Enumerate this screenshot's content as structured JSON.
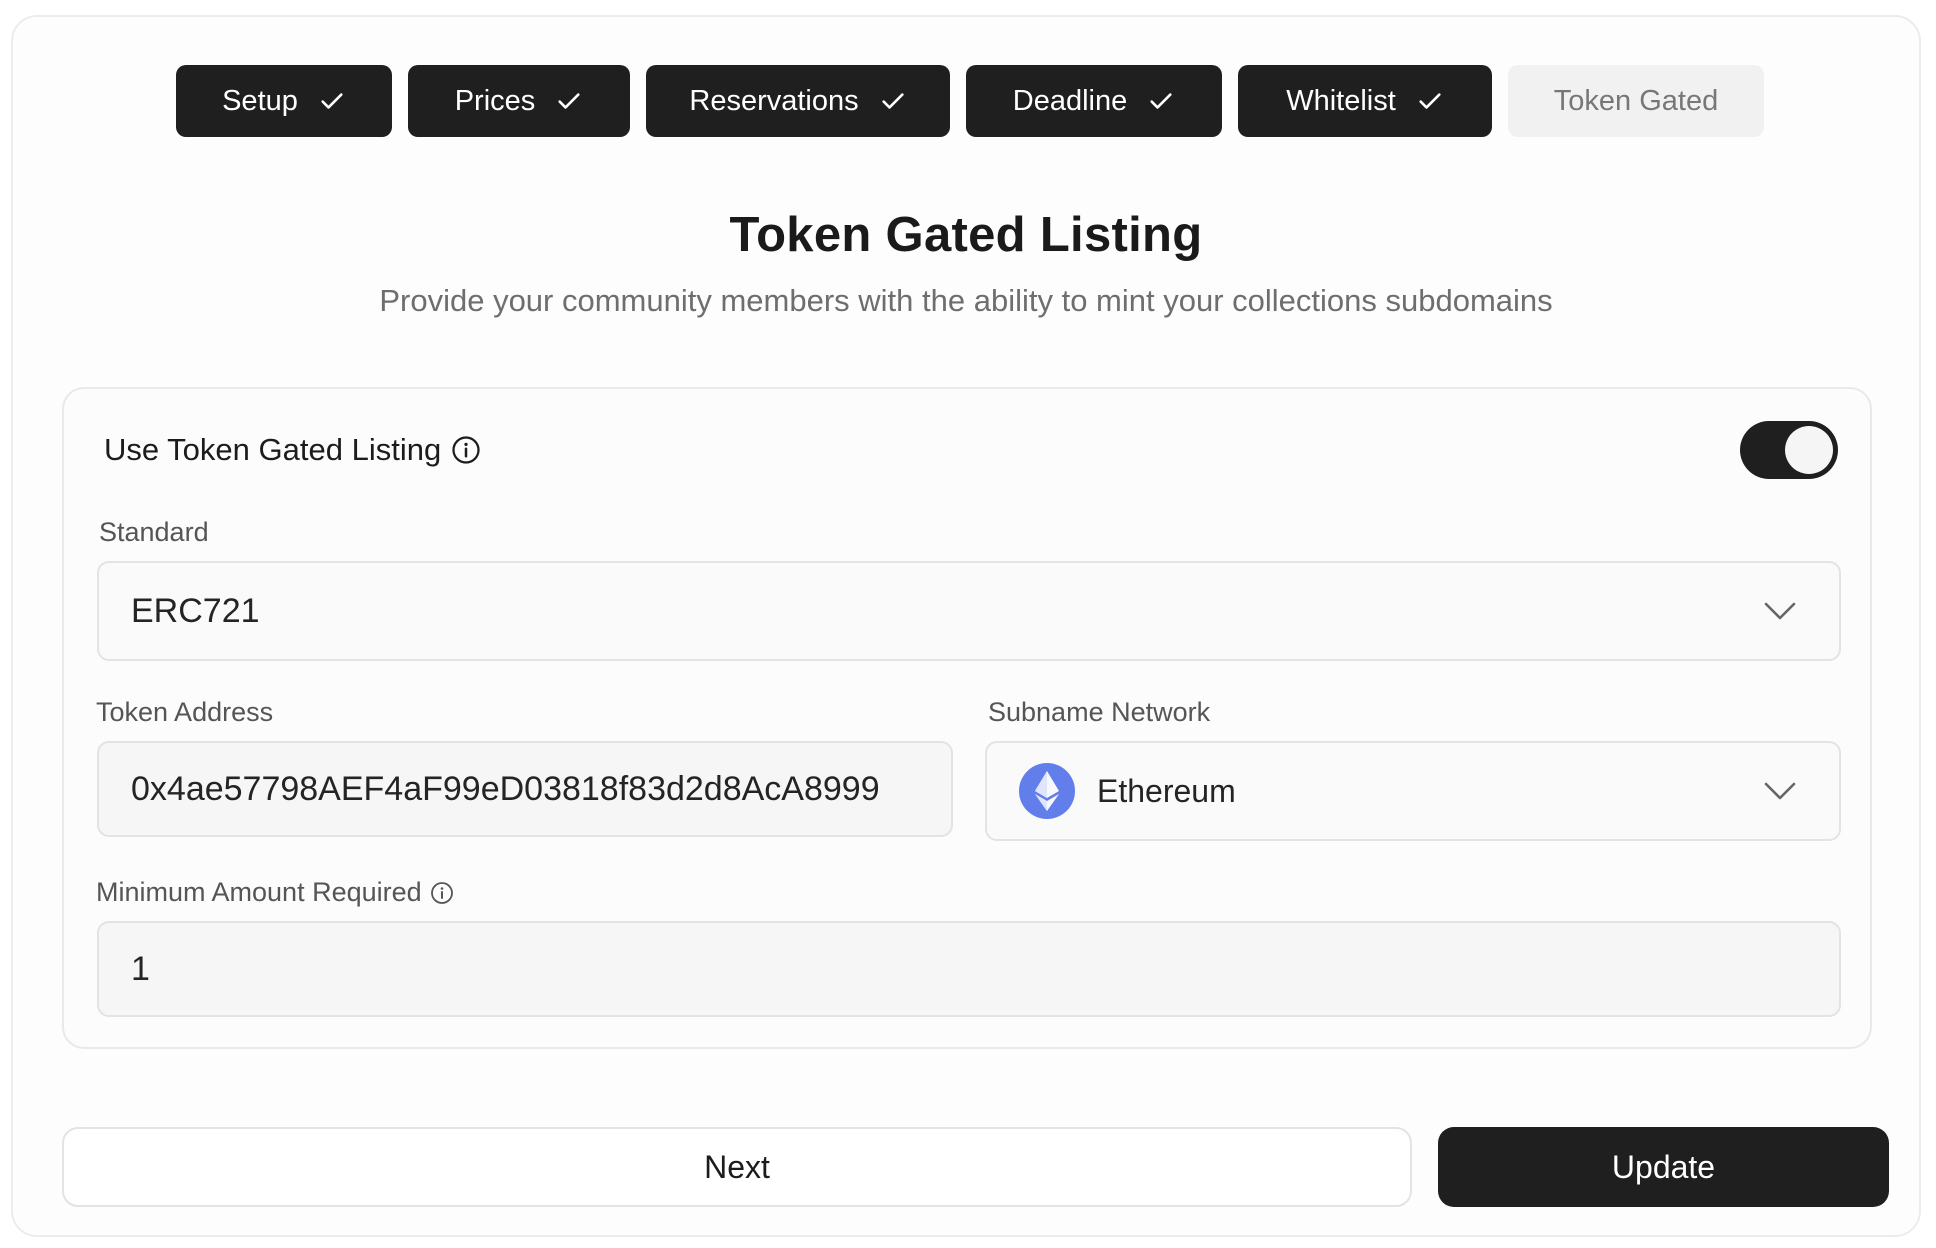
{
  "steps": [
    {
      "label": "Setup",
      "done": true
    },
    {
      "label": "Prices",
      "done": true
    },
    {
      "label": "Reservations",
      "done": true
    },
    {
      "label": "Deadline",
      "done": true
    },
    {
      "label": "Whitelist",
      "done": true
    },
    {
      "label": "Token Gated",
      "done": false
    }
  ],
  "page": {
    "title": "Token Gated Listing",
    "subtitle": "Provide your community members with the ability to mint your collections subdomains"
  },
  "form": {
    "toggle_label": "Use Token Gated Listing",
    "toggle_on": true,
    "standard_label": "Standard",
    "standard_value": "ERC721",
    "token_address_label": "Token Address",
    "token_address_value": "0x4ae57798AEF4aF99eD03818f83d2d8AcA8999",
    "network_label": "Subname Network",
    "network_value": "Ethereum",
    "min_amount_label": "Minimum Amount Required",
    "min_amount_value": "1"
  },
  "buttons": {
    "next": "Next",
    "update": "Update"
  },
  "colors": {
    "primary_dark": "#1f1f1f",
    "ethereum": "#627eea"
  }
}
